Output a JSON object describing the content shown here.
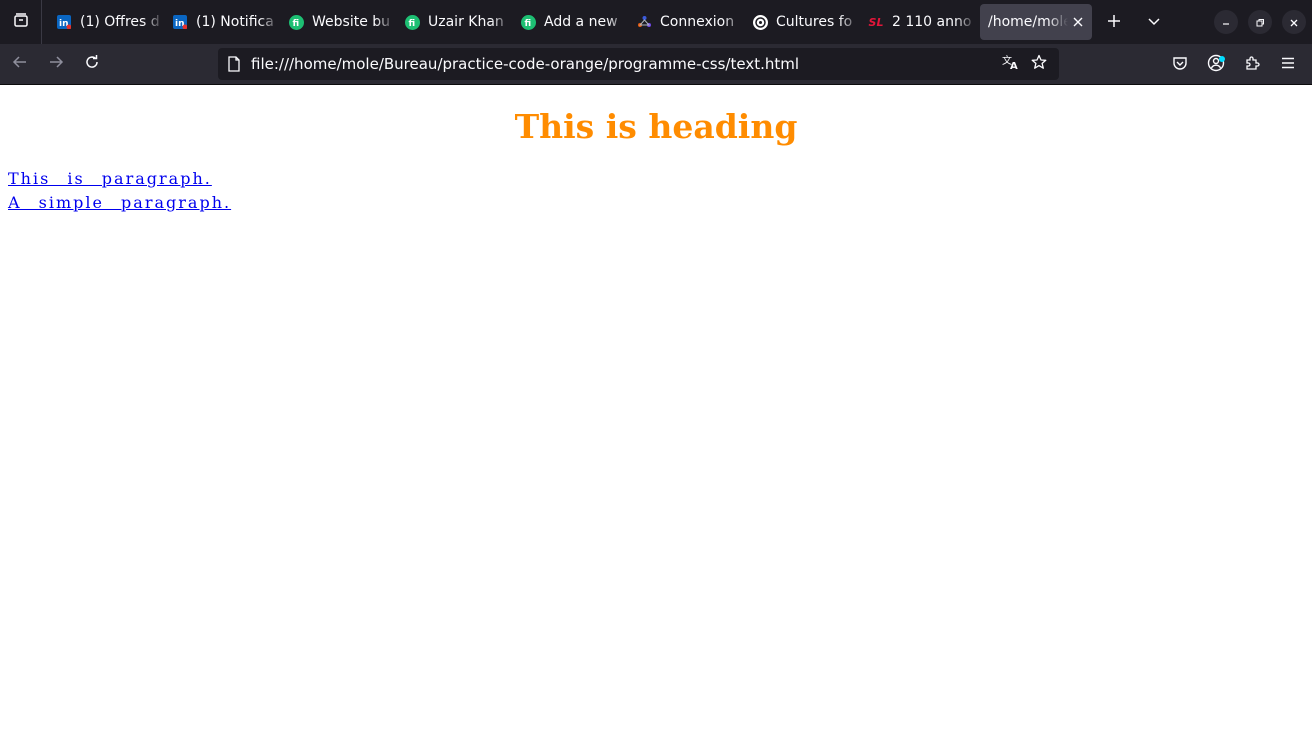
{
  "tabs": [
    {
      "title": "(1) Offres d",
      "icon": "linkedin-icon"
    },
    {
      "title": "(1) Notifica",
      "icon": "linkedin-icon"
    },
    {
      "title": "Website bu",
      "icon": "fiverr-icon"
    },
    {
      "title": "Uzair Khan",
      "icon": "fiverr-icon"
    },
    {
      "title": "Add a new",
      "icon": "fiverr-icon"
    },
    {
      "title": "Connexion",
      "icon": "connexion-icon"
    },
    {
      "title": "Cultures fo",
      "icon": "openai-icon"
    },
    {
      "title": "2 110 anno",
      "icon": "sl-icon",
      "icon_text": "SL"
    },
    {
      "title": "/home/mole",
      "icon": "",
      "active": true
    }
  ],
  "nav": {
    "url": "file:///home/mole/Bureau/practice-code-orange/programme-css/text.html"
  },
  "page": {
    "heading": "This is heading",
    "paragraph_1": "This is paragraph.",
    "paragraph_2": "A simple paragraph."
  },
  "colors": {
    "heading": "#ff8c00",
    "link": "#0000ee",
    "tabstrip_bg": "#1c1b22",
    "navbar_bg": "#2b2a33",
    "fiverr_green": "#1dbf73",
    "linkedin_blue": "#0a66c2"
  }
}
